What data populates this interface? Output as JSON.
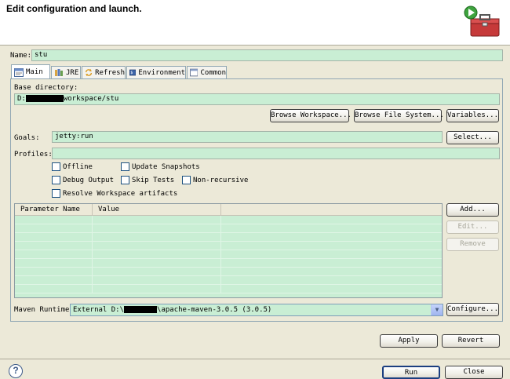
{
  "header": {
    "title": "Edit configuration and launch."
  },
  "name_label": "Name:",
  "name_value": "stu",
  "tabs": [
    {
      "label": "Main"
    },
    {
      "label": "JRE"
    },
    {
      "label": "Refresh"
    },
    {
      "label": "Environment"
    },
    {
      "label": "Common"
    }
  ],
  "main": {
    "base_dir_label": "Base directory:",
    "base_dir_prefix": "D:",
    "base_dir_suffix": "workspace/stu",
    "browse_workspace": "Browse Workspace...",
    "browse_filesystem": "Browse File System...",
    "variables": "Variables...",
    "goals_label": "Goals:",
    "goals_value": "jetty:run",
    "select": "Select...",
    "profiles_label": "Profiles:",
    "profiles_value": "",
    "checkboxes": {
      "offline": "Offline",
      "update_snapshots": "Update Snapshots",
      "debug_output": "Debug Output",
      "skip_tests": "Skip Tests",
      "non_recursive": "Non-recursive",
      "resolve_workspace": "Resolve Workspace artifacts"
    },
    "table": {
      "col_name": "Parameter Name",
      "col_value": "Value"
    },
    "add": "Add...",
    "edit": "Edit...",
    "remove": "Remove",
    "runtime_label": "Maven Runtime:",
    "runtime_prefix": "External D:\\",
    "runtime_suffix": "\\apache-maven-3.0.5 (3.0.5)",
    "configure": "Configure..."
  },
  "apply": "Apply",
  "revert": "Revert",
  "run": "Run",
  "close": "Close",
  "colors": {
    "field_bg": "#c9eed4",
    "dialog_bg": "#ece9d8"
  }
}
